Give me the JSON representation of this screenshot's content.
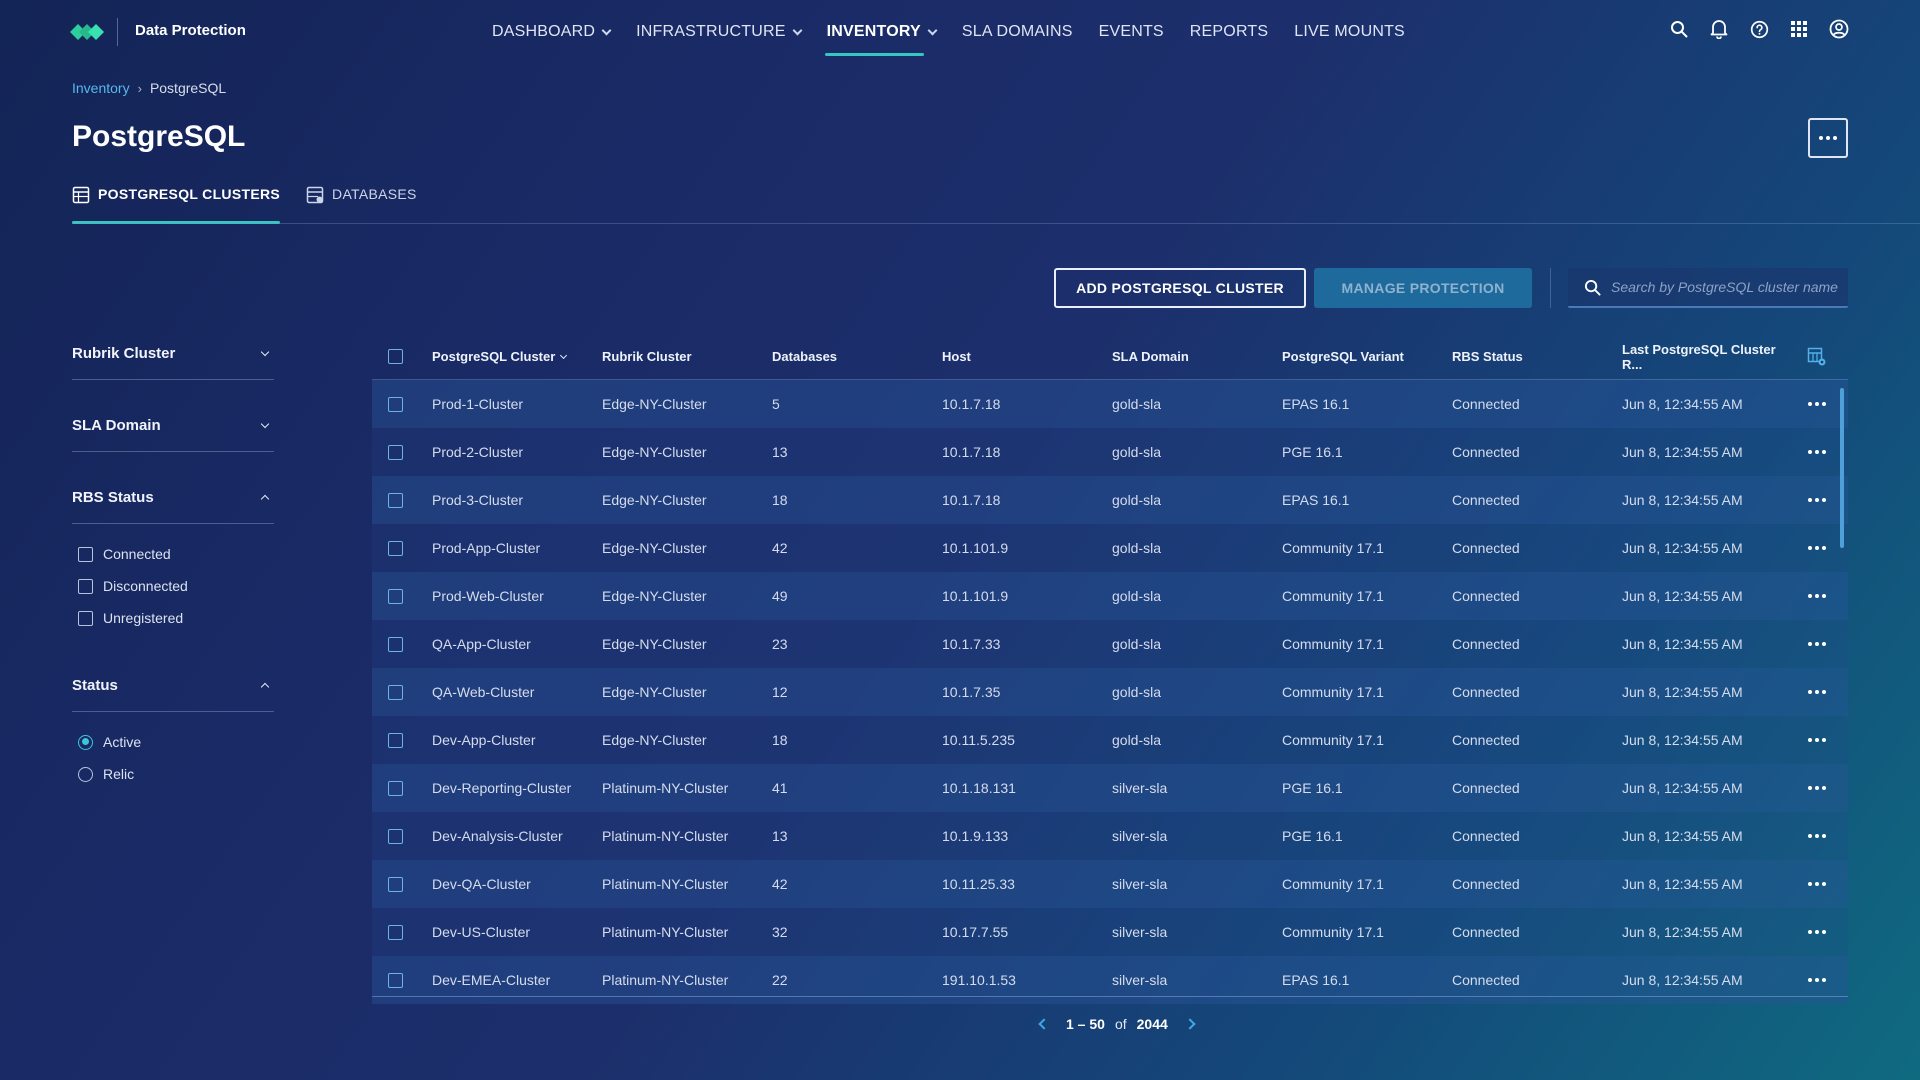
{
  "app": {
    "name": "Data Protection"
  },
  "nav": {
    "items": [
      {
        "label": "DASHBOARD",
        "dropdown": true,
        "active": false
      },
      {
        "label": "INFRASTRUCTURE",
        "dropdown": true,
        "active": false
      },
      {
        "label": "INVENTORY",
        "dropdown": true,
        "active": true
      },
      {
        "label": "SLA DOMAINS",
        "dropdown": false,
        "active": false
      },
      {
        "label": "EVENTS",
        "dropdown": false,
        "active": false
      },
      {
        "label": "REPORTS",
        "dropdown": false,
        "active": false
      },
      {
        "label": "LIVE MOUNTS",
        "dropdown": false,
        "active": false
      }
    ],
    "icons": [
      "search-icon",
      "bell-icon",
      "help-icon",
      "apps-grid-icon",
      "user-account-icon"
    ]
  },
  "breadcrumb": {
    "parent": "Inventory",
    "current": "PostgreSQL"
  },
  "page": {
    "title": "PostgreSQL"
  },
  "tabs": [
    {
      "label": "POSTGRESQL CLUSTERS",
      "active": true,
      "icon": "cluster-table-icon"
    },
    {
      "label": "DATABASES",
      "active": false,
      "icon": "database-table-icon"
    }
  ],
  "actions": {
    "add_label": "ADD POSTGRESQL CLUSTER",
    "manage_label": "MANAGE PROTECTION",
    "search_placeholder": "Search by PostgreSQL cluster name"
  },
  "filters": {
    "rubrik_cluster": "Rubrik Cluster",
    "sla_domain": "SLA Domain",
    "rbs_status": {
      "title": "RBS Status",
      "options": [
        "Connected",
        "Disconnected",
        "Unregistered"
      ]
    },
    "status": {
      "title": "Status",
      "options": [
        "Active",
        "Relic"
      ],
      "selected": "Active"
    }
  },
  "table": {
    "headers": [
      "PostgreSQL Cluster",
      "Rubrik Cluster",
      "Databases",
      "Host",
      "SLA Domain",
      "PostgreSQL Variant",
      "RBS Status",
      "Last PostgreSQL Cluster R..."
    ],
    "rows": [
      [
        "Prod-1-Cluster",
        "Edge-NY-Cluster",
        "5",
        "10.1.7.18",
        "gold-sla",
        "EPAS 16.1",
        "Connected",
        "Jun 8, 12:34:55 AM"
      ],
      [
        "Prod-2-Cluster",
        "Edge-NY-Cluster",
        "13",
        "10.1.7.18",
        "gold-sla",
        "PGE 16.1",
        "Connected",
        "Jun 8, 12:34:55 AM"
      ],
      [
        "Prod-3-Cluster",
        "Edge-NY-Cluster",
        "18",
        "10.1.7.18",
        "gold-sla",
        "EPAS 16.1",
        "Connected",
        "Jun 8, 12:34:55 AM"
      ],
      [
        "Prod-App-Cluster",
        "Edge-NY-Cluster",
        "42",
        "10.1.101.9",
        "gold-sla",
        "Community 17.1",
        "Connected",
        "Jun 8, 12:34:55 AM"
      ],
      [
        "Prod-Web-Cluster",
        "Edge-NY-Cluster",
        "49",
        "10.1.101.9",
        "gold-sla",
        "Community 17.1",
        "Connected",
        "Jun 8, 12:34:55 AM"
      ],
      [
        "QA-App-Cluster",
        "Edge-NY-Cluster",
        "23",
        "10.1.7.33",
        "gold-sla",
        "Community 17.1",
        "Connected",
        "Jun 8, 12:34:55 AM"
      ],
      [
        "QA-Web-Cluster",
        "Edge-NY-Cluster",
        "12",
        "10.1.7.35",
        "gold-sla",
        "Community 17.1",
        "Connected",
        "Jun 8, 12:34:55 AM"
      ],
      [
        "Dev-App-Cluster",
        "Edge-NY-Cluster",
        "18",
        "10.11.5.235",
        "gold-sla",
        "Community 17.1",
        "Connected",
        "Jun 8, 12:34:55 AM"
      ],
      [
        "Dev-Reporting-Cluster",
        "Platinum-NY-Cluster",
        "41",
        "10.1.18.131",
        "silver-sla",
        "PGE 16.1",
        "Connected",
        "Jun 8, 12:34:55 AM"
      ],
      [
        "Dev-Analysis-Cluster",
        "Platinum-NY-Cluster",
        "13",
        "10.1.9.133",
        "silver-sla",
        "PGE 16.1",
        "Connected",
        "Jun 8, 12:34:55 AM"
      ],
      [
        "Dev-QA-Cluster",
        "Platinum-NY-Cluster",
        "42",
        "10.11.25.33",
        "silver-sla",
        "Community 17.1",
        "Connected",
        "Jun 8, 12:34:55 AM"
      ],
      [
        "Dev-US-Cluster",
        "Platinum-NY-Cluster",
        "32",
        "10.17.7.55",
        "silver-sla",
        "Community 17.1",
        "Connected",
        "Jun 8, 12:34:55 AM"
      ],
      [
        "Dev-EMEA-Cluster",
        "Platinum-NY-Cluster",
        "22",
        "191.10.1.53",
        "silver-sla",
        "EPAS 16.1",
        "Connected",
        "Jun 8, 12:34:55 AM"
      ]
    ]
  },
  "pagination": {
    "range": "1 – 50",
    "of": "of",
    "total": "2044"
  },
  "colors": {
    "accent": "#35c7c0",
    "link": "#57b7ee",
    "brand": "#2ecf9c"
  }
}
